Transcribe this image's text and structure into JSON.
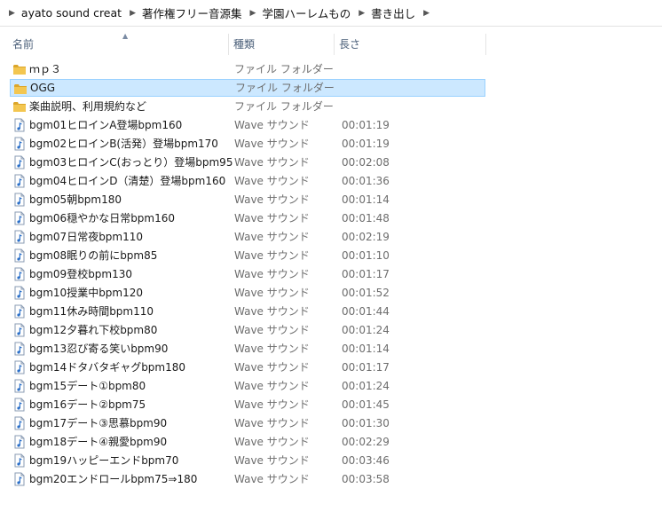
{
  "breadcrumb": [
    "ayato sound creat",
    "著作権フリー音源集",
    "学園ハーレムもの",
    "書き出し"
  ],
  "columns": {
    "name": "名前",
    "type": "種類",
    "length": "長さ"
  },
  "folders": [
    {
      "name": "ｍｐ３",
      "type": "ファイル フォルダー"
    },
    {
      "name": "OGG",
      "type": "ファイル フォルダー",
      "selected": true
    },
    {
      "name": "楽曲説明、利用規約など",
      "type": "ファイル フォルダー"
    }
  ],
  "files": [
    {
      "name": "bgm01ヒロインA登場bpm160",
      "type": "Wave サウンド",
      "length": "00:01:19"
    },
    {
      "name": "bgm02ヒロインB(活発）登場bpm170",
      "type": "Wave サウンド",
      "length": "00:01:19"
    },
    {
      "name": "bgm03ヒロインC(おっとり）登場bpm95",
      "type": "Wave サウンド",
      "length": "00:02:08"
    },
    {
      "name": "bgm04ヒロインD（清楚）登場bpm160",
      "type": "Wave サウンド",
      "length": "00:01:36"
    },
    {
      "name": "bgm05朝bpm180",
      "type": "Wave サウンド",
      "length": "00:01:14"
    },
    {
      "name": "bgm06穏やかな日常bpm160",
      "type": "Wave サウンド",
      "length": "00:01:48"
    },
    {
      "name": "bgm07日常夜bpm110",
      "type": "Wave サウンド",
      "length": "00:02:19"
    },
    {
      "name": "bgm08眠りの前にbpm85",
      "type": "Wave サウンド",
      "length": "00:01:10"
    },
    {
      "name": "bgm09登校bpm130",
      "type": "Wave サウンド",
      "length": "00:01:17"
    },
    {
      "name": "bgm10授業中bpm120",
      "type": "Wave サウンド",
      "length": "00:01:52"
    },
    {
      "name": "bgm11休み時間bpm110",
      "type": "Wave サウンド",
      "length": "00:01:44"
    },
    {
      "name": "bgm12夕暮れ下校bpm80",
      "type": "Wave サウンド",
      "length": "00:01:24"
    },
    {
      "name": "bgm13忍び寄る笑いbpm90",
      "type": "Wave サウンド",
      "length": "00:01:14"
    },
    {
      "name": "bgm14ドタバタギャグbpm180",
      "type": "Wave サウンド",
      "length": "00:01:17"
    },
    {
      "name": "bgm15デート①bpm80",
      "type": "Wave サウンド",
      "length": "00:01:24"
    },
    {
      "name": "bgm16デート②bpm75",
      "type": "Wave サウンド",
      "length": "00:01:45"
    },
    {
      "name": "bgm17デート③思慕bpm90",
      "type": "Wave サウンド",
      "length": "00:01:30"
    },
    {
      "name": "bgm18デート④親愛bpm90",
      "type": "Wave サウンド",
      "length": "00:02:29"
    },
    {
      "name": "bgm19ハッピーエンドbpm70",
      "type": "Wave サウンド",
      "length": "00:03:46"
    },
    {
      "name": "bgm20エンドロールbpm75⇒180",
      "type": "Wave サウンド",
      "length": "00:03:58"
    }
  ],
  "colors": {
    "selected_bg": "#cce8ff",
    "selected_border": "#99d1ff",
    "folder": "#e8b830",
    "header_text": "#4c607a"
  }
}
